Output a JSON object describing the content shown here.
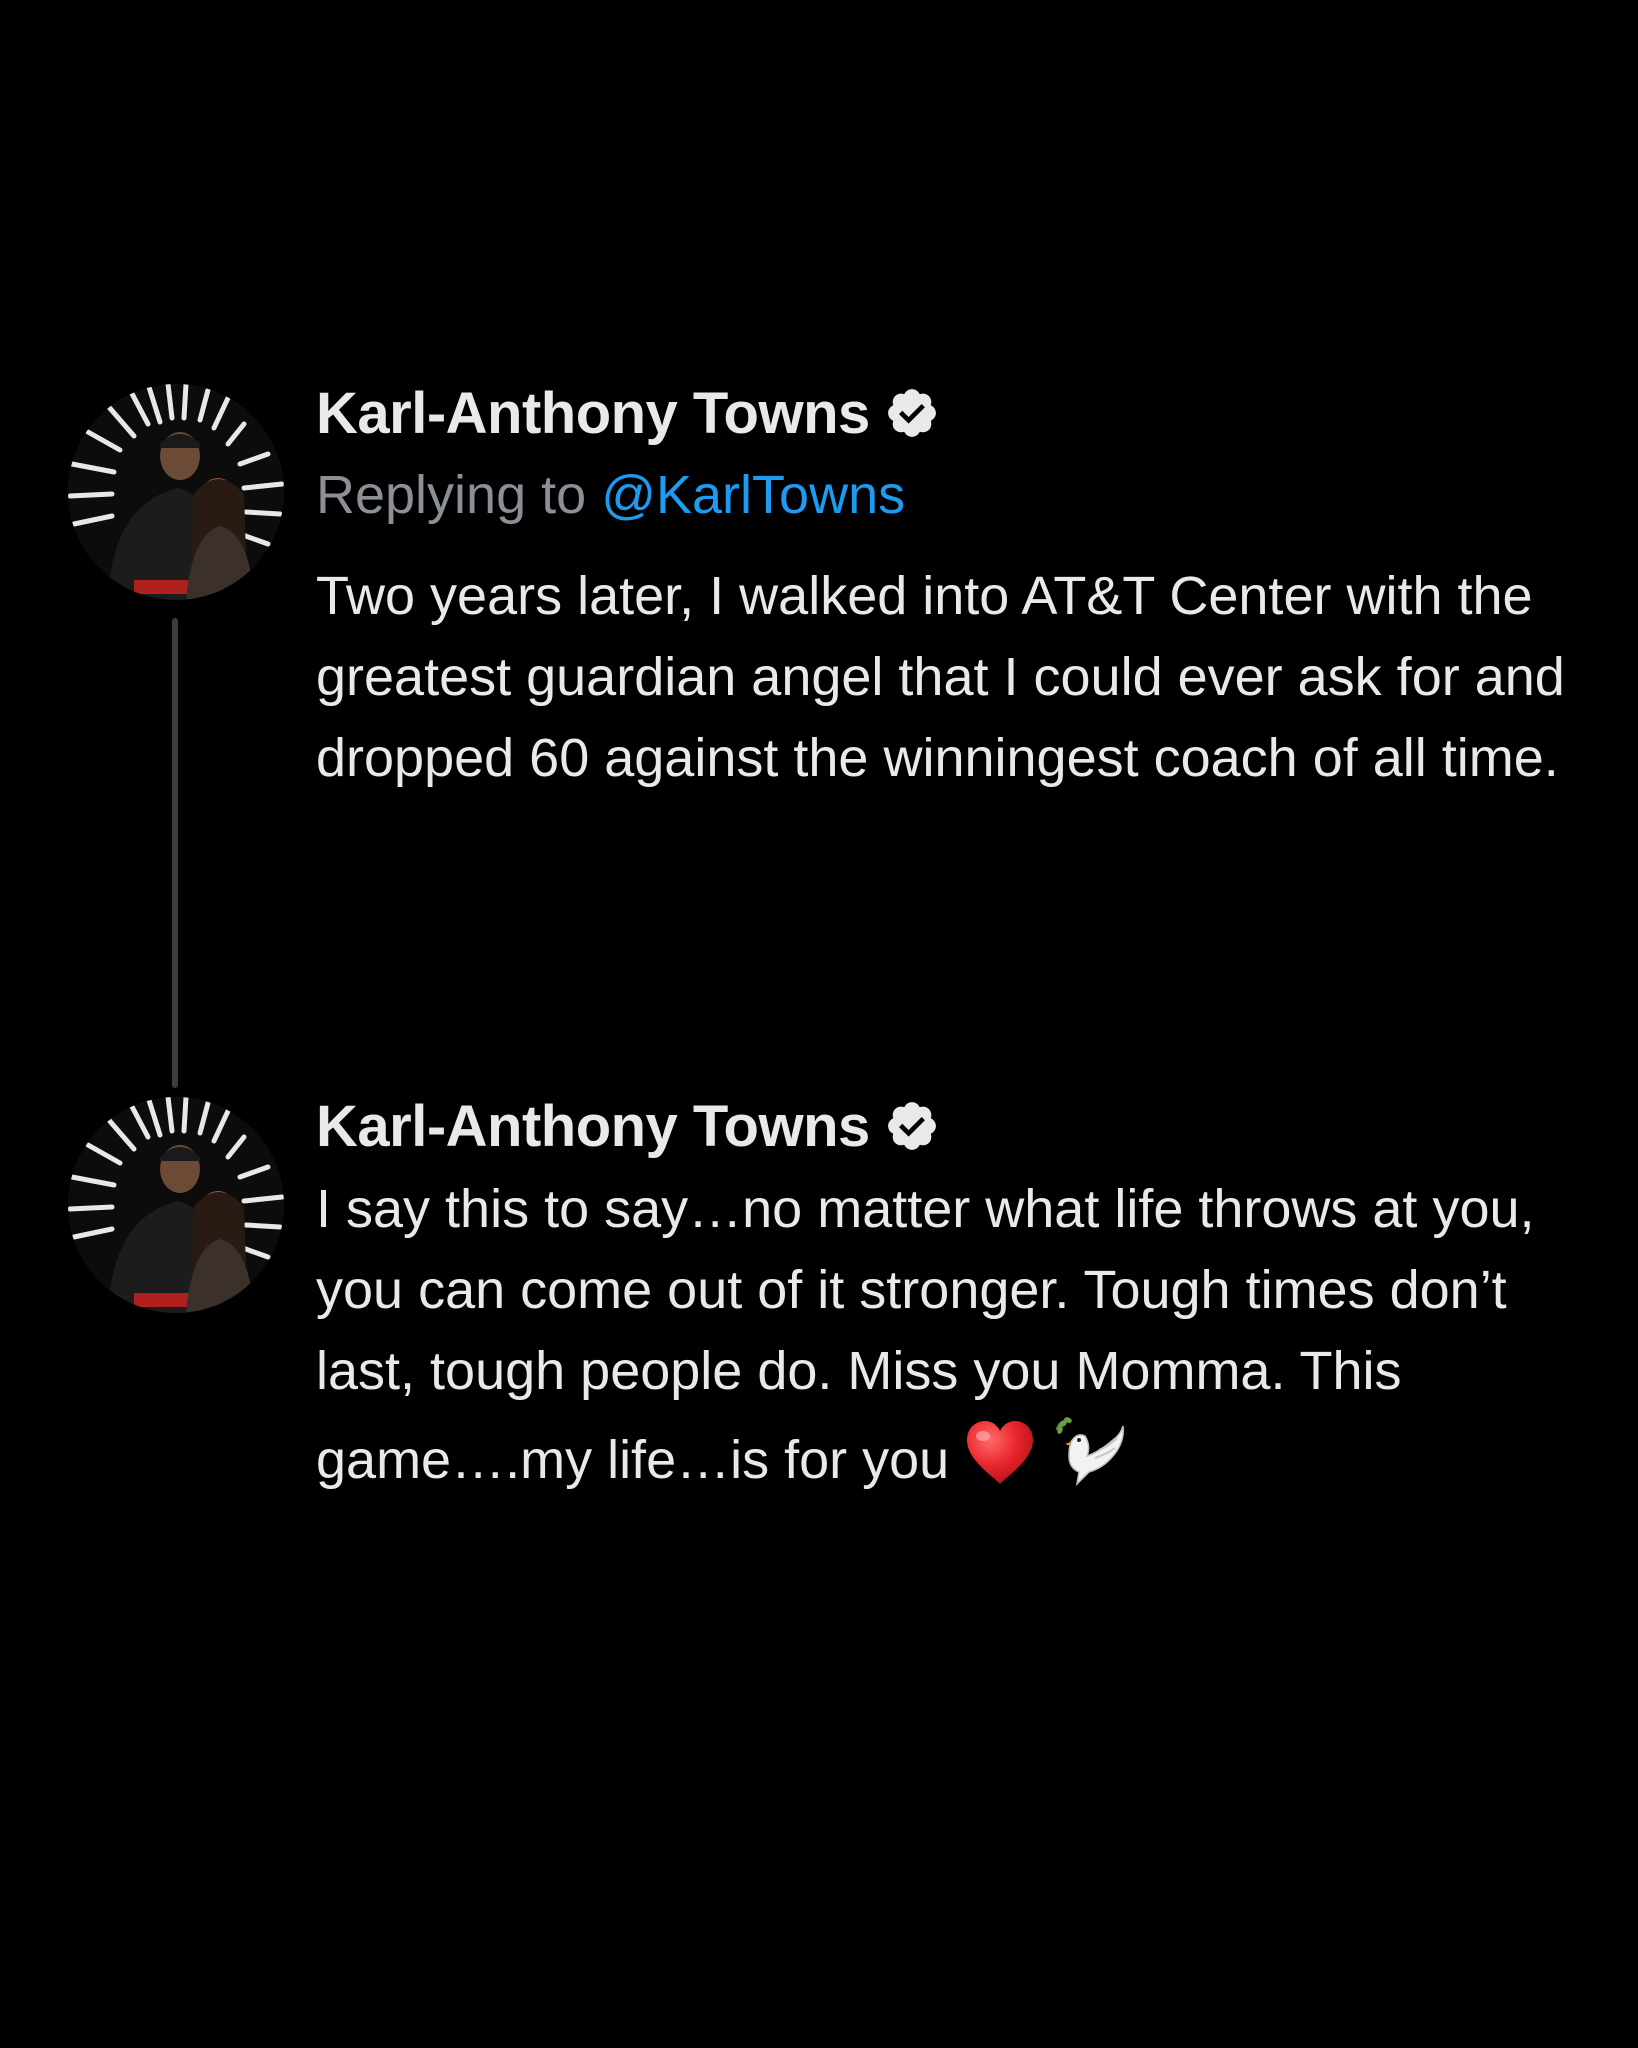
{
  "thread": {
    "tweets": [
      {
        "author": {
          "display_name": "Karl-Anthony Towns",
          "verified": true,
          "avatar_icon": "profile-photo-avatar"
        },
        "reply_to": {
          "prefix": "Replying to",
          "handle": "@KarlTowns"
        },
        "text": "Two years later, I walked into AT&T Center with the greatest guardian angel that I could ever ask for and dropped 60 against the winningest coach of all time."
      },
      {
        "author": {
          "display_name": "Karl-Anthony Towns",
          "verified": true,
          "avatar_icon": "profile-photo-avatar"
        },
        "text": "I say this to say…no matter what life throws at you, you can come out of it stronger. Tough times don’t last, tough people do. Miss you Momma. This game….my life…is for you",
        "emojis": [
          "red-heart-icon",
          "dove-icon"
        ]
      }
    ]
  },
  "colors": {
    "background": "#000000",
    "primary_text": "#e7e9ea",
    "secondary_text": "#8b9096",
    "link": "#1d9bf0",
    "thread_line": "#3a3d41"
  }
}
